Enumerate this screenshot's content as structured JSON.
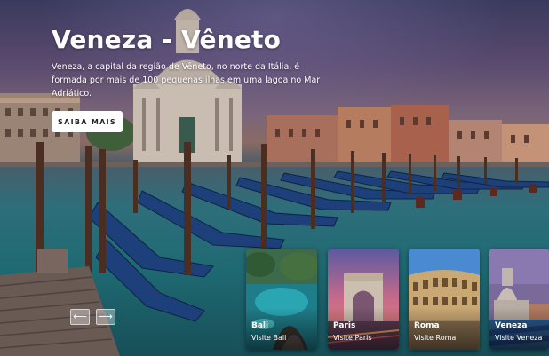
{
  "hero": {
    "title": "Veneza - Vêneto",
    "description": "Veneza, a capital da região de Vêneto, no norte da Itália, é formada por mais de 100 pequenas ilhas em uma lagoa no Mar Adriático.",
    "cta_label": "SAIBA MAIS"
  },
  "nav": {
    "prev_icon": "arrow-left-icon",
    "next_icon": "arrow-right-icon",
    "prev_glyph": "⟵",
    "next_glyph": "⟶"
  },
  "cards": [
    {
      "name": "Bali",
      "subtitle": "Visite Bali"
    },
    {
      "name": "Paris",
      "subtitle": "Visite Paris"
    },
    {
      "name": "Roma",
      "subtitle": "Visite Roma"
    },
    {
      "name": "Veneza",
      "subtitle": "Visite Veneza"
    }
  ],
  "colors": {
    "title": "#ffffff",
    "cta_background": "#ffffff",
    "cta_text": "#222222",
    "water": "#1f6a73"
  }
}
